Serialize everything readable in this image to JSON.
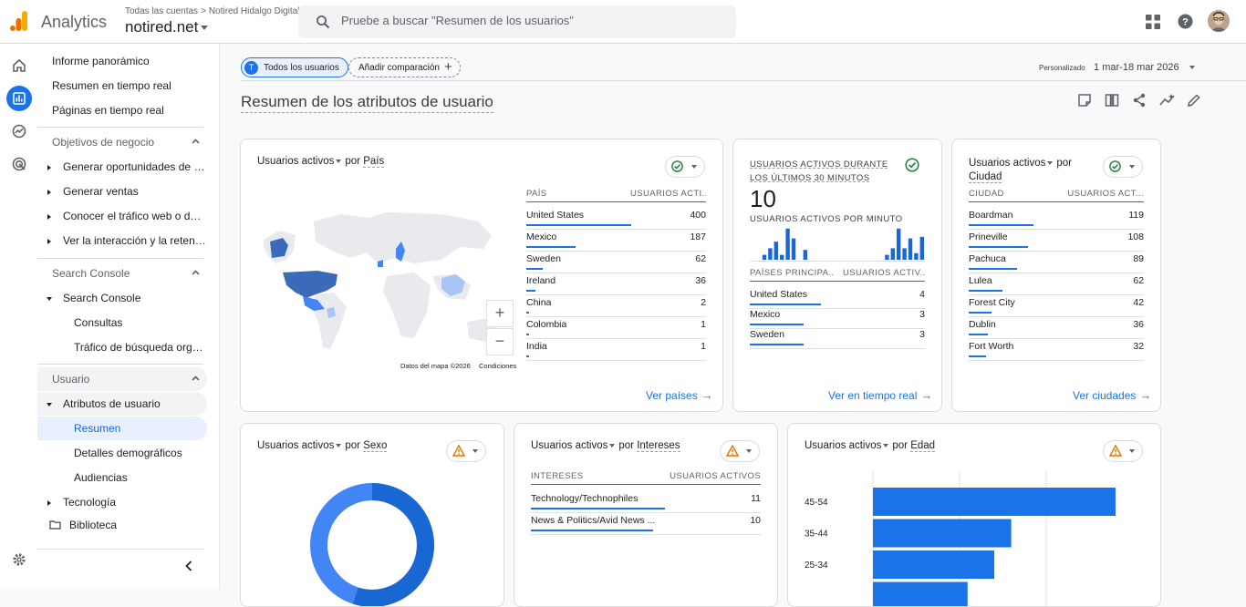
{
  "app": {
    "name": "Analytics",
    "breadcrumb_accounts": "Todas las cuentas",
    "breadcrumb_sep": ">",
    "breadcrumb_account": "Notired Hidalgo Digital",
    "property": "notired.net"
  },
  "search": {
    "placeholder": "Pruebe a buscar \"Resumen de los usuarios\""
  },
  "nav": {
    "items": {
      "informe": "Informe panorámico",
      "tiempo_real_resumen": "Resumen en tiempo real",
      "tiempo_real_paginas": "Páginas en tiempo real",
      "objetivos_header": "Objetivos de negocio",
      "oportunidades": "Generar oportunidades de v...",
      "ventas": "Generar ventas",
      "trafico": "Conocer el tráfico web o de a...",
      "interaccion": "Ver la interacción y la retenci...",
      "search_console_header": "Search Console",
      "search_console": "Search Console",
      "consultas": "Consultas",
      "trafico_busqueda": "Tráfico de búsqueda orgán...",
      "usuario_header": "Usuario",
      "atributos": "Atributos de usuario",
      "resumen": "Resumen",
      "demograficos": "Detalles demográficos",
      "audiencias": "Audiencias",
      "tecnologia": "Tecnología",
      "biblioteca": "Biblioteca"
    }
  },
  "toolbar": {
    "chip_all_letter": "T",
    "chip_all": "Todos los usuarios",
    "chip_add": "Añadir comparación",
    "chip_add_plus": "+",
    "date_label": "Personalizado",
    "date_range": "1 mar-18 mar 2026"
  },
  "page": {
    "title": "Resumen de los atributos de usuario"
  },
  "cards": {
    "country": {
      "metric": "Usuarios activos",
      "by": "por",
      "dimension": "País",
      "col1": "PAÍS",
      "col2": "USUARIOS ACTI...",
      "rows": [
        {
          "label": "United States",
          "value": "400",
          "pct": 1.0
        },
        {
          "label": "Mexico",
          "value": "187",
          "pct": 0.47
        },
        {
          "label": "Sweden",
          "value": "62",
          "pct": 0.16
        },
        {
          "label": "Ireland",
          "value": "36",
          "pct": 0.09
        },
        {
          "label": "China",
          "value": "2",
          "pct": 0.01
        },
        {
          "label": "Colombia",
          "value": "1",
          "pct": 0.005
        },
        {
          "label": "India",
          "value": "1",
          "pct": 0.005
        }
      ],
      "map_attr": "Datos del mapa ©2026",
      "map_terms": "Condiciones",
      "zoom_in": "+",
      "zoom_out": "−",
      "link": "Ver países",
      "link_arrow": "→"
    },
    "realtime": {
      "title": "USUARIOS ACTIVOS DURANTE LOS ÚLTIMOS 30 MINUTOS",
      "value": "10",
      "per_minute": "USUARIOS ACTIVOS POR MINUTO",
      "minute_bars": [
        0,
        0,
        0.15,
        0.35,
        0.55,
        0.15,
        0.95,
        0.65,
        0,
        0.3,
        0,
        0,
        0,
        0,
        0,
        0,
        0,
        0,
        0,
        0,
        0,
        0,
        0,
        0.15,
        0.35,
        0.95,
        0.35,
        0.65,
        0.2,
        0.7
      ],
      "col1": "PAÍSES PRINCIPA...",
      "col2": "USUARIOS ACTIV...",
      "rows": [
        {
          "label": "United States",
          "value": "4",
          "pct": 1.0
        },
        {
          "label": "Mexico",
          "value": "3",
          "pct": 0.75
        },
        {
          "label": "Sweden",
          "value": "3",
          "pct": 0.75
        }
      ],
      "link": "Ver en tiempo real",
      "link_arrow": "→"
    },
    "city": {
      "metric": "Usuarios activos",
      "by": "por",
      "dimension": "Ciudad",
      "col1": "CIUDAD",
      "col2": "USUARIOS ACT...",
      "rows": [
        {
          "label": "Boardman",
          "value": "119",
          "pct": 1.0
        },
        {
          "label": "Prineville",
          "value": "108",
          "pct": 0.91
        },
        {
          "label": "Pachuca",
          "value": "89",
          "pct": 0.75
        },
        {
          "label": "Lulea",
          "value": "62",
          "pct": 0.52
        },
        {
          "label": "Forest City",
          "value": "42",
          "pct": 0.35
        },
        {
          "label": "Dublin",
          "value": "36",
          "pct": 0.3
        },
        {
          "label": "Fort Worth",
          "value": "32",
          "pct": 0.27
        }
      ],
      "link": "Ver ciudades",
      "link_arrow": "→"
    },
    "gender": {
      "metric": "Usuarios activos",
      "by": "por",
      "dimension": "Sexo",
      "share": [
        0.55,
        0.45
      ]
    },
    "interests": {
      "metric": "Usuarios activos",
      "by": "por",
      "dimension": "Intereses",
      "col1": "INTERESES",
      "col2": "USUARIOS ACTIVOS",
      "rows": [
        {
          "label": "Technology/Technophiles",
          "value": "11",
          "pct": 1.0
        },
        {
          "label": "News & Politics/Avid News ...",
          "value": "10",
          "pct": 0.91
        }
      ]
    },
    "age": {
      "metric": "Usuarios activos",
      "by": "por",
      "dimension": "Edad",
      "rows": [
        {
          "label": "45-54",
          "pct": 1.0
        },
        {
          "label": "35-44",
          "pct": 0.57
        },
        {
          "label": "25-34",
          "pct": 0.5
        },
        {
          "label": "",
          "pct": 0.39
        }
      ]
    }
  },
  "colors": {
    "accent": "#1a73e8",
    "dark_blue": "#1967d2",
    "map_highlight": "#4285f4",
    "warning": "#e37400",
    "success": "#188038"
  }
}
